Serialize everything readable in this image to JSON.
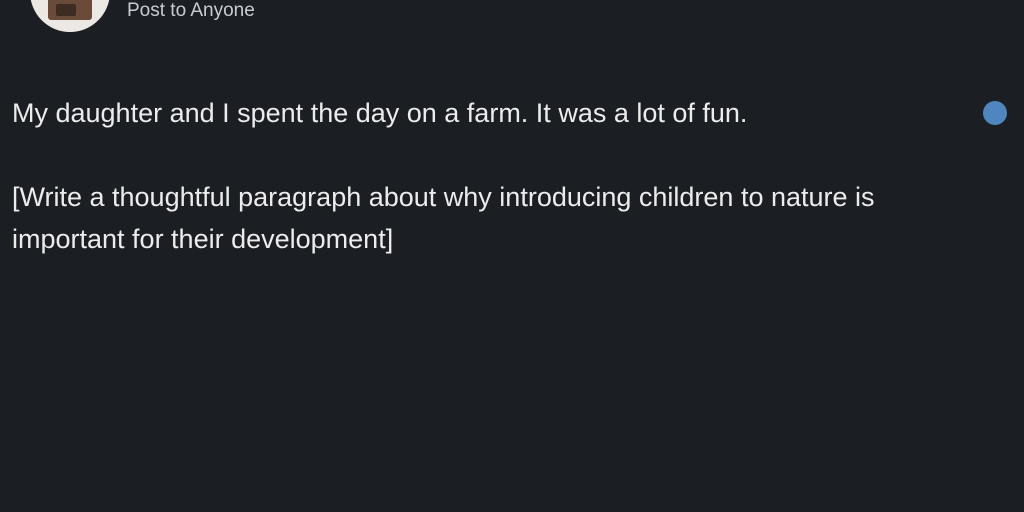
{
  "header": {
    "visibility_label": "Post to Anyone"
  },
  "editor": {
    "paragraphs": [
      "My daughter and I spent the day on a farm. It was a lot of fun.",
      "[Write a thoughtful paragraph about why introducing children to nature is important for their development]"
    ]
  },
  "indicator": {
    "color": "#4f86c0"
  }
}
